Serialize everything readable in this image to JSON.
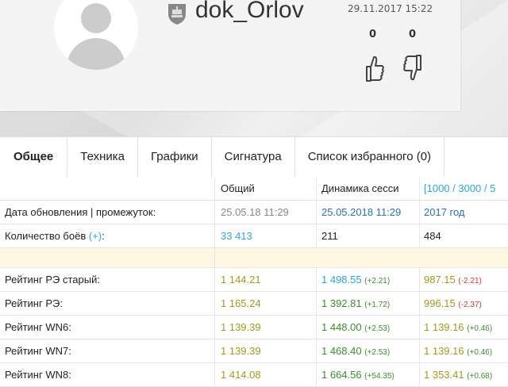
{
  "profile": {
    "username": "dok_Orlov",
    "date": "29.11.2017 15:22",
    "likes": "0",
    "dislikes": "0"
  },
  "tabs": [
    {
      "label": "Общее",
      "active": true
    },
    {
      "label": "Техника"
    },
    {
      "label": "Графики"
    },
    {
      "label": "Сигнатура"
    },
    {
      "label": "Список избранного (0)"
    }
  ],
  "table": {
    "headers": [
      "Общий",
      "Динамика сесси",
      "[1000 / 3000 / 5"
    ],
    "rows": {
      "updated": {
        "label": "Дата обновления | промежуток:",
        "c1": "25.05.18 11:29",
        "c2": "25.05.2018 11:29",
        "c3": "2017 год"
      },
      "battles": {
        "label": "Количество боёв",
        "plus": "(+)",
        "colon": ":",
        "c1": "33 413",
        "c2": "211",
        "c3": "484"
      },
      "re_old": {
        "label": "Рейтинг РЭ старый:",
        "c1": "1 144.21",
        "c2": "1 498.55",
        "c2d": "(+2.21)",
        "c3": "987.15",
        "c3d": "(-2.21)"
      },
      "re": {
        "label": "Рейтинг РЭ:",
        "c1": "1 165.24",
        "c2": "1 392.81",
        "c2d": "(+1.72)",
        "c3": "996.15",
        "c3d": "(-2.37)"
      },
      "wn6": {
        "label": "Рейтинг WN6:",
        "c1": "1 139.39",
        "c2": "1 448.00",
        "c2d": "(+2.53)",
        "c3": "1 139.16",
        "c3d": "(+0.46)"
      },
      "wn7": {
        "label": "Рейтинг WN7:",
        "c1": "1 139.39",
        "c2": "1 468.40",
        "c2d": "(+2.53)",
        "c3": "1 139.16",
        "c3d": "(+0.46)"
      },
      "wn8": {
        "label": "Рейтинг WN8:",
        "c1": "1 414.08",
        "c2": "1 664.56",
        "c2d": "(+54.35)",
        "c3": "1 353.41",
        "c3d": "(+0.68)"
      }
    }
  },
  "colors": {
    "blue": "#2aa7d8",
    "green": "#3a8f2a",
    "olive": "#a39a18",
    "red": "#d33333",
    "highlight": "#fdf7e1"
  }
}
